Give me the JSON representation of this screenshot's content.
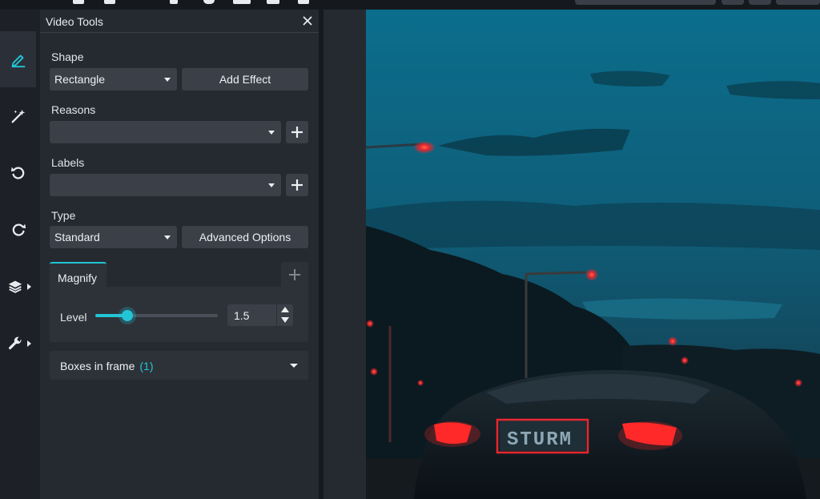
{
  "panel": {
    "title": "Video Tools",
    "shape": {
      "label": "Shape",
      "selected": "Rectangle",
      "add_effect_label": "Add Effect"
    },
    "reasons": {
      "label": "Reasons",
      "selected": ""
    },
    "labels": {
      "label": "Labels",
      "selected": ""
    },
    "type": {
      "label": "Type",
      "selected": "Standard",
      "advanced_label": "Advanced Options"
    },
    "magnify": {
      "tab_label": "Magnify",
      "level_label": "Level",
      "level_value": "1.5",
      "slider_fraction": 0.26
    },
    "boxes": {
      "label": "Boxes in frame",
      "count": "(1)"
    }
  },
  "sidebar": {
    "tools": [
      {
        "name": "pencil-icon",
        "active": true
      },
      {
        "name": "magic-wand-icon",
        "active": false
      },
      {
        "name": "undo-icon",
        "active": false
      },
      {
        "name": "redo-icon",
        "active": false
      },
      {
        "name": "layers-icon",
        "active": false
      },
      {
        "name": "wrench-icon",
        "active": false
      }
    ]
  },
  "canvas": {
    "plate_text": "STURM",
    "box_color": "#e8272e"
  },
  "colors": {
    "accent": "#22c5d6",
    "panel": "#252a31",
    "control": "#3a3f48"
  }
}
